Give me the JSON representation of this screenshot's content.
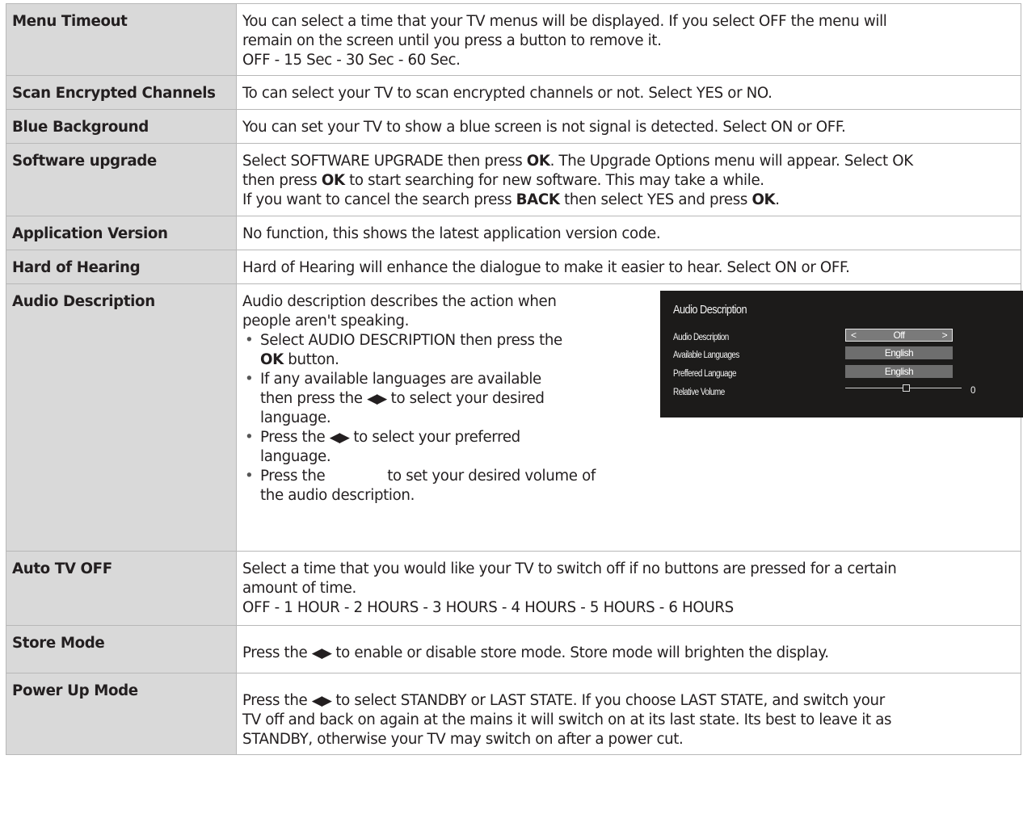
{
  "rows": [
    {
      "setting": "Menu Timeout",
      "lines": [
        "You can select a time that your TV menus will be displayed. If you select OFF the menu will",
        "remain on the screen until you press a button to remove it.",
        "OFF - 15 Sec - 30 Sec - 60 Sec."
      ]
    },
    {
      "setting": "Scan Encrypted Channels",
      "lines": [
        "To can select your TV to scan encrypted channels or not. Select YES or NO."
      ]
    },
    {
      "setting": "Blue Background",
      "lines": [
        "You can set your TV to show a blue screen is not signal is detected. Select ON or OFF."
      ]
    },
    {
      "setting": "Software upgrade",
      "l1a": "Select SOFTWARE UPGRADE then press ",
      "l1b": "OK",
      "l1c": ". The Upgrade Options menu will appear. Select OK",
      "l2a": "then press ",
      "l2b": "OK",
      "l2c": " to start searching for new software. This may take a while.",
      "l3a": "If you want to cancel the search press ",
      "l3b": "BACK",
      "l3c": " then select YES and press ",
      "l3d": "OK",
      "l3e": "."
    },
    {
      "setting": "Application Version",
      "lines": [
        "No function, this shows the latest application version code."
      ]
    },
    {
      "setting": "Hard of Hearing",
      "lines": [
        "Hard of Hearing will enhance the dialogue to make it easier to hear. Select ON or OFF."
      ]
    },
    {
      "setting": "Audio Description",
      "intro1": "Audio description describes the action when",
      "intro2": "people aren't speaking.",
      "b1a": "Select AUDIO DESCRIPTION then press the",
      "b1b": "OK",
      "b1c": " button.",
      "b2a": "If any available languages are available",
      "b2b": "then press the ",
      "b2c": " to select your desired",
      "b2d": "language.",
      "b3a": "Press the ",
      "b3b": " to select your preferred",
      "b3c": "language.",
      "b4a": "Press the ",
      "b4b": " to set your desired volume of",
      "b4c": "the audio description.",
      "arrows": "◀▶"
    },
    {
      "setting": "Auto TV OFF",
      "lines": [
        "Select a time that you would like your TV to switch off if no buttons are pressed for a certain",
        "amount of time.",
        "OFF - 1 HOUR - 2 HOURS - 3 HOURS - 4 HOURS - 5 HOURS - 6 HOURS"
      ]
    },
    {
      "setting": "Store Mode",
      "a": "Press the ",
      "arrows": "◀▶",
      "b": " to enable or disable store mode. Store mode will brighten the display."
    },
    {
      "setting": "Power Up Mode",
      "a": "Press the ",
      "arrows": "◀▶",
      "b": " to select STANDBY or LAST STATE. If you choose LAST STATE, and switch your",
      "l2": "TV off and back on again at the mains it will switch on at its last state. Its best to leave it as",
      "l3": "STANDBY, otherwise your TV may switch on after a power cut."
    }
  ],
  "osd": {
    "title": "Audio Description",
    "rows": [
      {
        "label": "Audio Description",
        "value": "Off",
        "left": "<",
        "right": ">"
      },
      {
        "label": "Available Languages",
        "value": "English"
      },
      {
        "label": "Preffered Language",
        "value": "English"
      },
      {
        "label": "Relative Volume",
        "value": "0"
      }
    ]
  }
}
